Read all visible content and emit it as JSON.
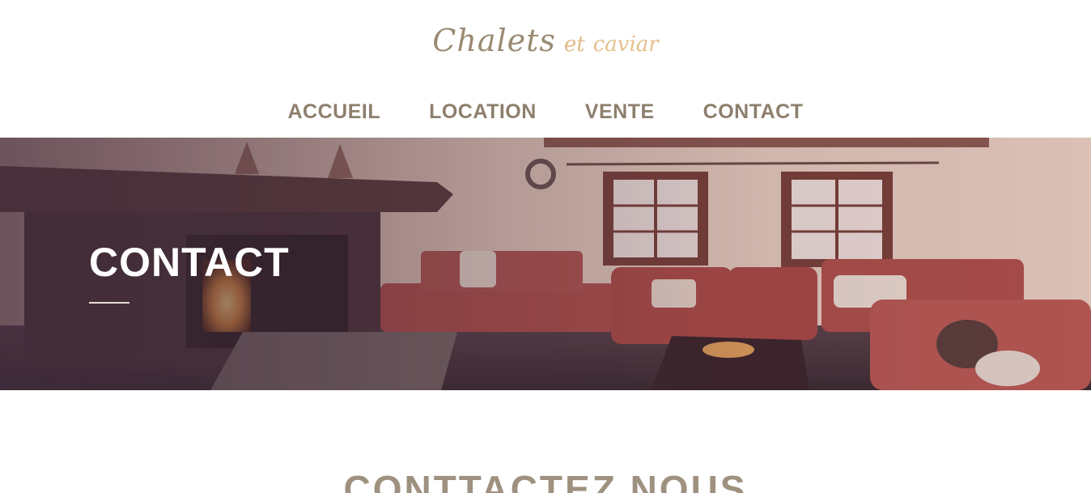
{
  "header": {
    "logo": {
      "word1": "Chalets",
      "amp": "et",
      "word2": "caviar",
      "color_primary": "#9a8a72",
      "color_accent": "#e3b98a"
    }
  },
  "nav": {
    "items": [
      {
        "label": "ACCUEIL"
      },
      {
        "label": "LOCATION"
      },
      {
        "label": "VENTE"
      },
      {
        "label": "CONTACT"
      }
    ],
    "color": "#8d7f6d"
  },
  "hero": {
    "title": "CONTACT",
    "image_subject": "chalet living room with fireplace"
  },
  "main": {
    "section_title": "CONTTACTEZ NOUS"
  }
}
